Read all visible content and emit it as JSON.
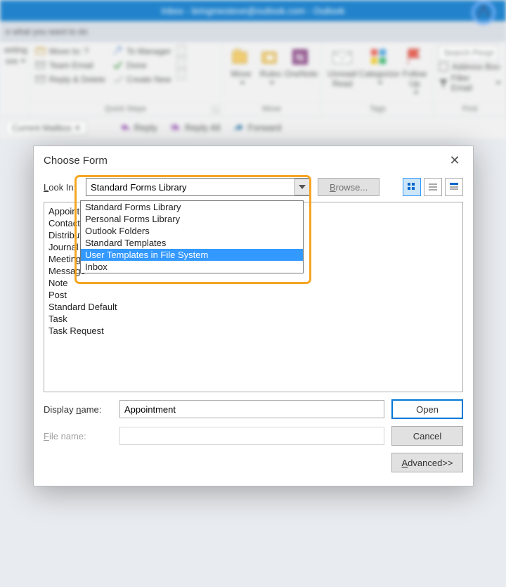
{
  "title_bar": {
    "text": "Inbox - bringmesteve@outlook.com  -  Outlook"
  },
  "tell_me": {
    "placeholder": "e what you want to do"
  },
  "ribbon": {
    "meeting": {
      "label1": "eeting",
      "label2": "ore"
    },
    "quick_steps": {
      "caption": "Quick Steps",
      "items_left": [
        "Move to: ?",
        "Team Email",
        "Reply & Delete"
      ],
      "items_right": [
        "To Manager",
        "Done",
        "Create New"
      ]
    },
    "move": {
      "caption": "Move",
      "move": "Move",
      "rules": "Rules",
      "onenote": "OneNote"
    },
    "tags": {
      "caption": "Tags",
      "unread": "Unread/\nRead",
      "categorize": "Categorize",
      "followup": "Follow\nUp"
    },
    "find": {
      "caption": "Find",
      "search_ph": "Search People",
      "address": "Address Boo",
      "filter": "Filter Email"
    }
  },
  "bar2": {
    "mailbox": "Current Mailbox",
    "reply": "Reply",
    "reply_all": "Reply All",
    "forward": "Forward"
  },
  "dialog": {
    "title": "Choose Form",
    "lookin": "Look In:",
    "combo_value": "Standard Forms Library",
    "combo_options": [
      "Standard Forms Library",
      "Personal Forms Library",
      "Outlook Folders",
      "Standard Templates",
      "User Templates in File System",
      "Inbox"
    ],
    "browse": "Browse...",
    "form_list": [
      "Appointment",
      "Contact",
      "Distribution List",
      "Journal Entry",
      "Meeting Request",
      "Message",
      "Note",
      "Post",
      "Standard Default",
      "Task",
      "Task Request"
    ],
    "display_name_label": "Display name:",
    "display_name_value": "Appointment",
    "file_name_label": "File name:",
    "file_name_value": "",
    "open": "Open",
    "cancel": "Cancel",
    "advanced": "Advanced>>"
  }
}
